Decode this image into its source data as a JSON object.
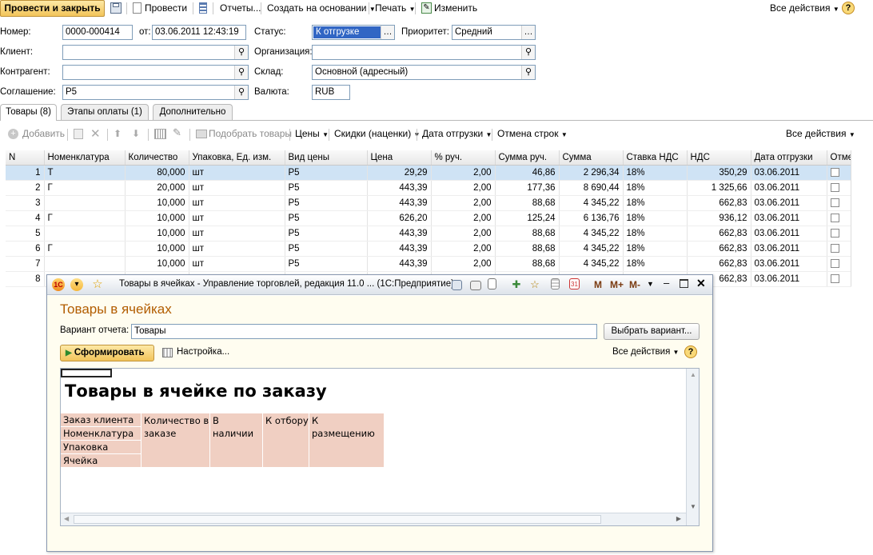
{
  "toolbar": {
    "post_close": "Провести и закрыть",
    "post": "Провести",
    "reports": "Отчеты...",
    "create_based": "Создать на основании",
    "print": "Печать",
    "edit": "Изменить",
    "all_actions": "Все действия",
    "help": "?"
  },
  "form": {
    "number_label": "Номер:",
    "number": "0000-000414",
    "from_label": "от:",
    "date": "03.06.2011 12:43:19",
    "status_label": "Статус:",
    "status": "К отгрузке",
    "priority_label": "Приоритет:",
    "priority": "Средний",
    "client_label": "Клиент:",
    "client": "",
    "org_label": "Организация:",
    "org": "",
    "contractor_label": "Контрагент:",
    "contractor": "",
    "warehouse_label": "Склад:",
    "warehouse": "Основной (адресный)",
    "agreement_label": "Соглашение:",
    "agreement": "Р5",
    "currency_label": "Валюта:",
    "currency": "RUB"
  },
  "tabs": [
    "Товары (8)",
    "Этапы оплаты (1)",
    "Дополнительно"
  ],
  "goods_toolbar": {
    "add": "Добавить",
    "pick": "Подобрать товары",
    "prices": "Цены",
    "discounts": "Скидки (наценки)",
    "ship_date": "Дата отгрузки",
    "cancel_rows": "Отмена строк",
    "all_actions": "Все действия"
  },
  "table": {
    "columns": [
      "N",
      "Номенклатура",
      "Количество",
      "Упаковка, Ед. изм.",
      "Вид цены",
      "Цена",
      "% руч.",
      "Сумма руч.",
      "Сумма",
      "Ставка НДС",
      "НДС",
      "Дата отгрузки",
      "Отме"
    ],
    "rows": [
      {
        "n": "1",
        "item": "Т",
        "qty": "80,000",
        "unit": "шт",
        "price_type": "Р5",
        "price": "29,29",
        "pct": "2,00",
        "sum_manual": "46,86",
        "sum": "2 296,34",
        "vat_rate": "18%",
        "vat": "350,29",
        "date": "03.06.2011"
      },
      {
        "n": "2",
        "item": "Г",
        "qty": "20,000",
        "unit": "шт",
        "price_type": "Р5",
        "price": "443,39",
        "pct": "2,00",
        "sum_manual": "177,36",
        "sum": "8 690,44",
        "vat_rate": "18%",
        "vat": "1 325,66",
        "date": "03.06.2011"
      },
      {
        "n": "3",
        "item": "",
        "qty": "10,000",
        "unit": "шт",
        "price_type": "Р5",
        "price": "443,39",
        "pct": "2,00",
        "sum_manual": "88,68",
        "sum": "4 345,22",
        "vat_rate": "18%",
        "vat": "662,83",
        "date": "03.06.2011"
      },
      {
        "n": "4",
        "item": "Г",
        "qty": "10,000",
        "unit": "шт",
        "price_type": "Р5",
        "price": "626,20",
        "pct": "2,00",
        "sum_manual": "125,24",
        "sum": "6 136,76",
        "vat_rate": "18%",
        "vat": "936,12",
        "date": "03.06.2011"
      },
      {
        "n": "5",
        "item": "",
        "qty": "10,000",
        "unit": "шт",
        "price_type": "Р5",
        "price": "443,39",
        "pct": "2,00",
        "sum_manual": "88,68",
        "sum": "4 345,22",
        "vat_rate": "18%",
        "vat": "662,83",
        "date": "03.06.2011"
      },
      {
        "n": "6",
        "item": "Г",
        "qty": "10,000",
        "unit": "шт",
        "price_type": "Р5",
        "price": "443,39",
        "pct": "2,00",
        "sum_manual": "88,68",
        "sum": "4 345,22",
        "vat_rate": "18%",
        "vat": "662,83",
        "date": "03.06.2011"
      },
      {
        "n": "7",
        "item": "",
        "qty": "10,000",
        "unit": "шт",
        "price_type": "Р5",
        "price": "443,39",
        "pct": "2,00",
        "sum_manual": "88,68",
        "sum": "4 345,22",
        "vat_rate": "18%",
        "vat": "662,83",
        "date": "03.06.2011"
      },
      {
        "n": "8",
        "item": "",
        "qty": "",
        "unit": "",
        "price_type": "",
        "price": "",
        "pct": "",
        "sum_manual": "",
        "sum": "",
        "vat_rate": "",
        "vat": "662,83",
        "date": "03.06.2011"
      }
    ]
  },
  "report_window": {
    "title": "Товары в ячейках - Управление торговлей, редакция 11.0 ... (1С:Предприятие)",
    "m": "M",
    "mplus": "M+",
    "mminus": "M-",
    "heading": "Товары в ячейках",
    "variant_label": "Вариант отчета:",
    "variant": "Товары",
    "choose_variant": "Выбрать вариант...",
    "generate": "Сформировать",
    "settings": "Настройка...",
    "all_actions": "Все действия",
    "help": "?",
    "report_title": "Товары в ячейке по заказу",
    "header_rows": [
      "Заказ клиента",
      "Номенклатура",
      "Упаковка",
      "Ячейка"
    ],
    "col_qty": "Количество в заказе",
    "col_stock": "В наличии",
    "col_pick": "К отбору",
    "col_place": "К размещению"
  }
}
